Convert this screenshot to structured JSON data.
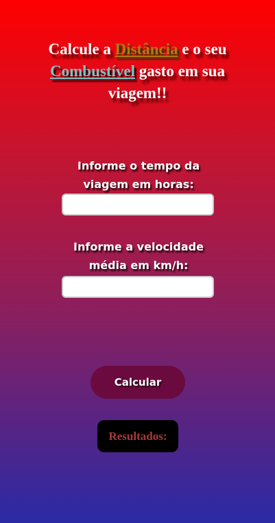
{
  "heading": {
    "part1": "Calcule a ",
    "distance_word": "Distância",
    "part2": " e o seu ",
    "fuel_word": "Combustível",
    "part3": " gasto em sua viagem!!"
  },
  "form": {
    "time_label": "Informe o tempo da viagem em horas:",
    "time_value": "",
    "speed_label": "Informe a velocidade média em km/h:",
    "speed_value": "",
    "calculate_label": "Calcular"
  },
  "results": {
    "label": "Resultados:"
  },
  "colors": {
    "gradient_top": "#ff0000",
    "gradient_bottom": "#2a2aa6",
    "button_bg": "#6a0a3e",
    "distance_word": "#b07a10",
    "fuel_word": "#7cc2c6",
    "results_text": "#a83a3a"
  }
}
